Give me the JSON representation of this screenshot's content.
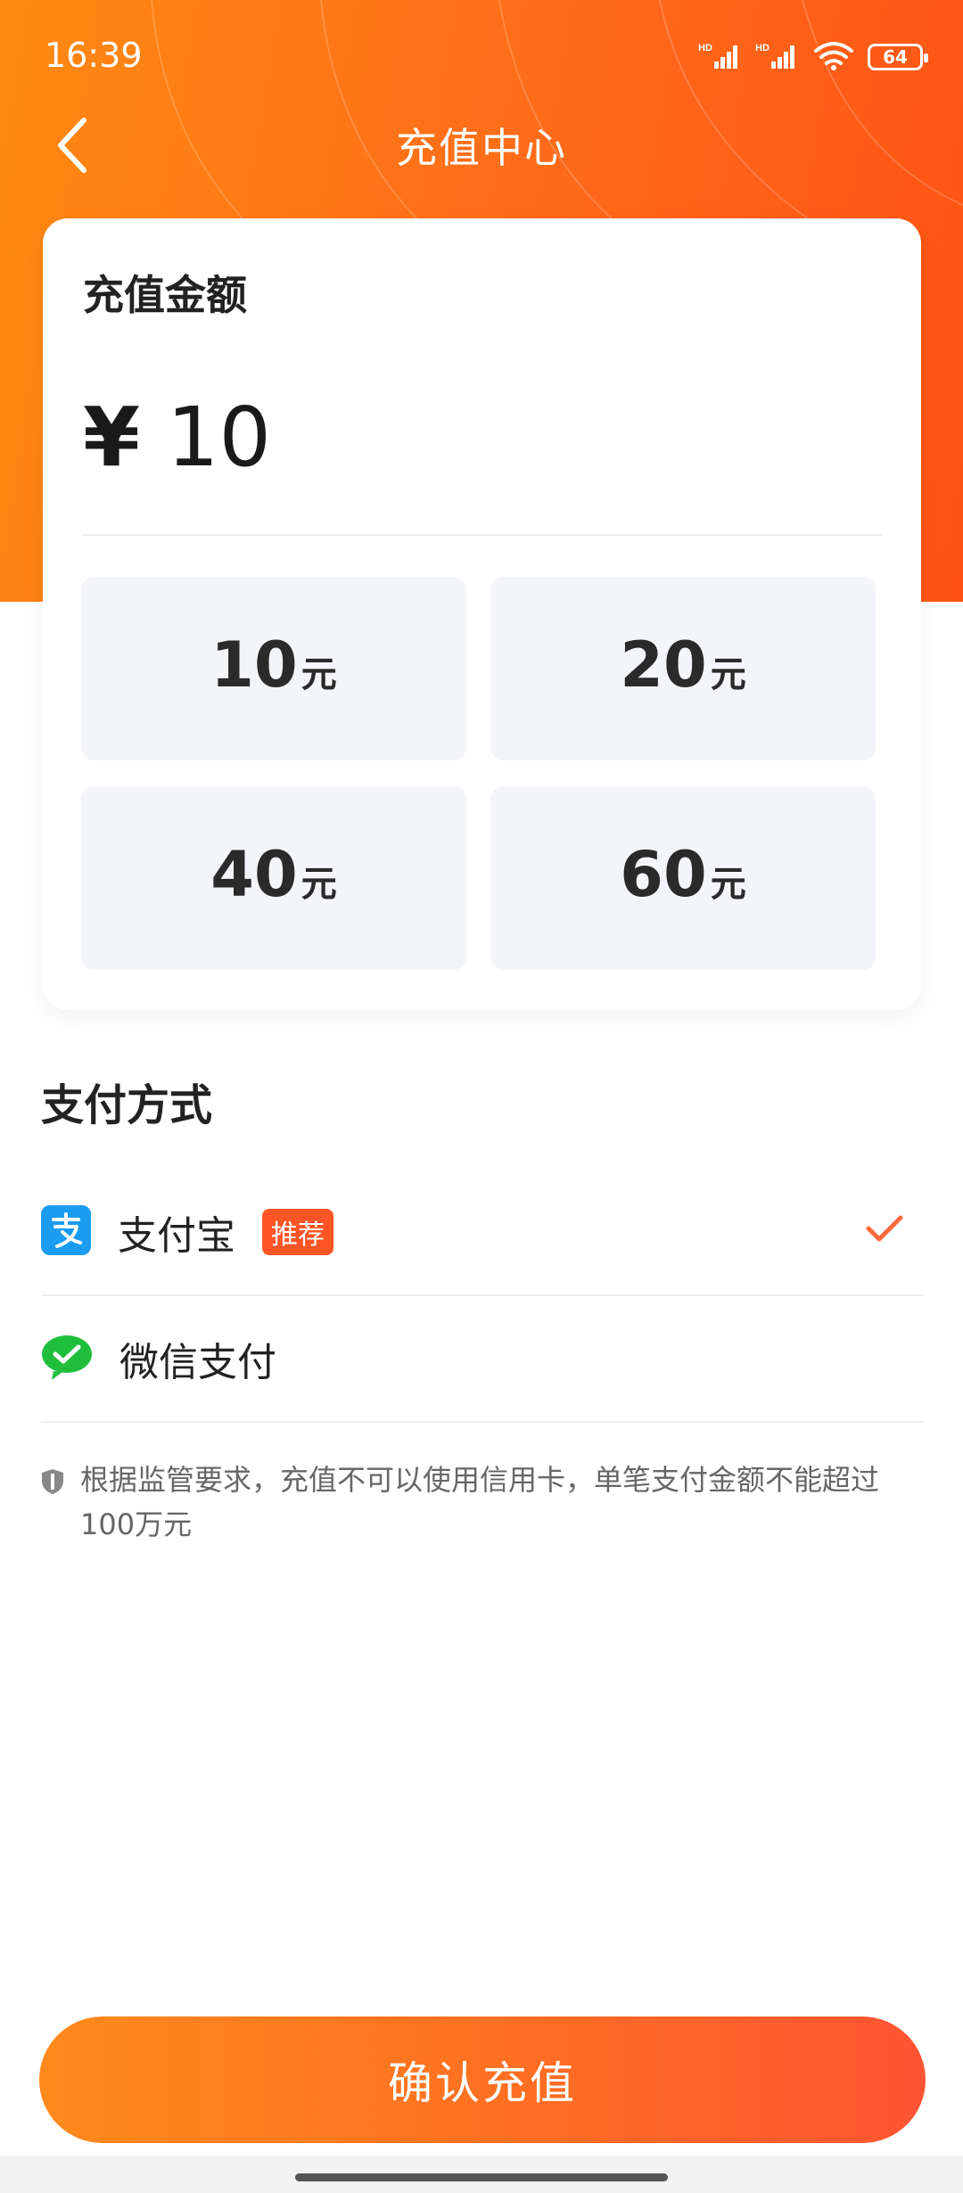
{
  "status_bar": {
    "time": "16:39",
    "battery": "64",
    "signal_label": "HD"
  },
  "nav": {
    "title": "充值中心"
  },
  "amount_card": {
    "title": "充值金额",
    "currency_symbol": "¥",
    "amount": "10",
    "unit": "元",
    "options": [
      {
        "value": "10"
      },
      {
        "value": "20"
      },
      {
        "value": "40"
      },
      {
        "value": "60"
      }
    ]
  },
  "payment": {
    "title": "支付方式",
    "methods": [
      {
        "name": "支付宝",
        "badge": "推荐",
        "icon": "alipay-icon",
        "selected": true
      },
      {
        "name": "微信支付",
        "icon": "wechat-pay-icon",
        "selected": false
      }
    ]
  },
  "notice": {
    "text": "根据监管要求，充值不可以使用信用卡，单笔支付金额不能超过100万元"
  },
  "confirm_button": {
    "label": "确认充值"
  },
  "colors": {
    "accent": "#ff6a1a",
    "badge": "#ff5526",
    "check": "#ff6a3d"
  }
}
